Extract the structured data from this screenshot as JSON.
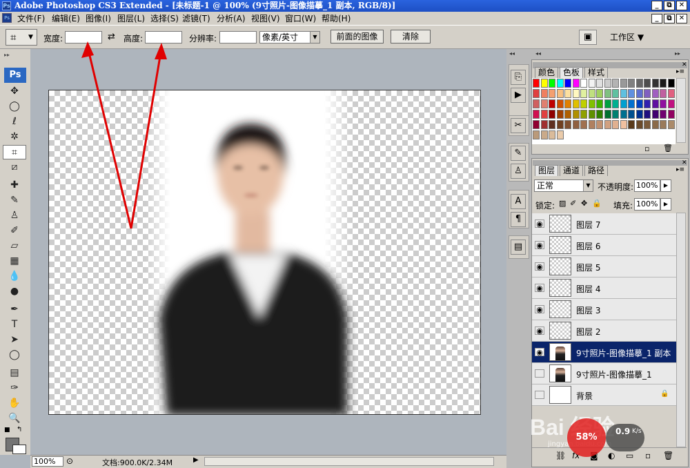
{
  "window": {
    "app_icon": "Ps",
    "title": "Adobe Photoshop CS3 Extended - [未标题-1 @ 100% (9寸照片-图像描摹_1 副本, RGB/8)]",
    "min": "_",
    "restore": "⧉",
    "close": "✕"
  },
  "menu": [
    "文件(F)",
    "编辑(E)",
    "图像(I)",
    "图层(L)",
    "选择(S)",
    "滤镜(T)",
    "分析(A)",
    "视图(V)",
    "窗口(W)",
    "帮助(H)"
  ],
  "options": {
    "width_label": "宽度:",
    "width_value": "",
    "swap": "⇄",
    "height_label": "高度:",
    "height_value": "",
    "resolution_label": "分辨率:",
    "resolution_value": "",
    "unit": "像素/英寸",
    "front_image_btn": "前面的图像",
    "clear_btn": "清除",
    "workspace_btn": "工作区 ▼"
  },
  "tools": {
    "logo": "Ps",
    "items": [
      "move-tool",
      "marquee-tool",
      "lasso-tool",
      "magic-wand-tool",
      "crop-tool",
      "slice-tool",
      "healing-brush-tool",
      "brush-tool",
      "clone-stamp-tool",
      "history-brush-tool",
      "eraser-tool",
      "gradient-tool",
      "blur-tool",
      "dodge-tool",
      "pen-tool",
      "type-tool",
      "path-selection-tool",
      "shape-tool",
      "notes-tool",
      "eyedropper-tool",
      "hand-tool",
      "zoom-tool"
    ],
    "glyphs": [
      "✥",
      "◯",
      "ℓ",
      "✲",
      "⌗",
      "⧄",
      "✚",
      "✎",
      "♙",
      "✐",
      "▱",
      "▦",
      "💧",
      "●",
      "✒",
      "T",
      "➤",
      "◯",
      "▤",
      "✑",
      "✋",
      "🔍"
    ]
  },
  "status": {
    "zoom": "100%",
    "doc_info": "文档:900.0K/2.34M"
  },
  "swatches_panel": {
    "tabs": [
      "颜色",
      "色板",
      "样式"
    ],
    "active": "色板",
    "colors": [
      "#ff0000",
      "#ffff00",
      "#00ff00",
      "#00ffff",
      "#0000ff",
      "#ff00ff",
      "#ffffff",
      "#f2f2f2",
      "#e0e0e0",
      "#cccccc",
      "#b3b3b3",
      "#999999",
      "#808080",
      "#666666",
      "#4d4d4d",
      "#333333",
      "#1a1a1a",
      "#000000",
      "#e04040",
      "#f08060",
      "#f4a070",
      "#f8c080",
      "#fce0a0",
      "#fff8c0",
      "#e0f0a0",
      "#c0e080",
      "#a0d060",
      "#80c080",
      "#60c0a0",
      "#60c0e0",
      "#6090e0",
      "#6070d0",
      "#8060c0",
      "#a060c0",
      "#c060a0",
      "#e06080",
      "#d06060",
      "#e08070",
      "#c00000",
      "#d05000",
      "#e08000",
      "#e0c000",
      "#c0d000",
      "#80c000",
      "#40b000",
      "#00a040",
      "#00b090",
      "#00a0d0",
      "#0070d0",
      "#0040c0",
      "#3020b0",
      "#6010a0",
      "#9010a0",
      "#c01080",
      "#d01050",
      "#e04040",
      "#900000",
      "#a04000",
      "#b06000",
      "#b09000",
      "#90a000",
      "#609000",
      "#308000",
      "#007030",
      "#008070",
      "#007090",
      "#005090",
      "#003090",
      "#201080",
      "#400070",
      "#700070",
      "#900060",
      "#900030",
      "#a03030",
      "#603020",
      "#704020",
      "#805030",
      "#906040",
      "#a07050",
      "#b08060",
      "#c09070",
      "#d0a080",
      "#e0b090",
      "#f0c0a0",
      "#5a3a1a",
      "#6a4a2a",
      "#7a5a3a",
      "#8a6a4a",
      "#9a7a5a",
      "#aa8a6a",
      "#ba9a7a",
      "#caaa8a",
      "#dabb9a",
      "#eacbaa"
    ]
  },
  "layers_panel": {
    "tabs": [
      "图层",
      "通道",
      "路径"
    ],
    "active": "图层",
    "blend_mode": "正常",
    "opacity_label": "不透明度:",
    "opacity_value": "100%",
    "lock_label": "锁定:",
    "fill_label": "填充:",
    "fill_value": "100%",
    "layers": [
      {
        "name": "图层 7",
        "visible": true,
        "selected": false
      },
      {
        "name": "图层 6",
        "visible": true,
        "selected": false
      },
      {
        "name": "图层 5",
        "visible": true,
        "selected": false
      },
      {
        "name": "图层 4",
        "visible": true,
        "selected": false
      },
      {
        "name": "图层 3",
        "visible": true,
        "selected": false
      },
      {
        "name": "图层 2",
        "visible": true,
        "selected": false
      },
      {
        "name": "9寸照片-图像描摹_1 副本",
        "visible": true,
        "selected": true
      },
      {
        "name": "9寸照片-图像描摹_1",
        "visible": false,
        "selected": false
      },
      {
        "name": "背景",
        "visible": false,
        "selected": false
      }
    ]
  },
  "watermark": {
    "brand": "Bai 经验",
    "url": "jingyan.baidu.com",
    "speed": "0.9",
    "speed_unit": "K/s",
    "percent": "58%"
  },
  "colors": {
    "title_blue": "#1d4fc4",
    "chrome": "#d4d0c8",
    "selected_layer": "#0a246a",
    "arrow_red": "#e00000"
  }
}
